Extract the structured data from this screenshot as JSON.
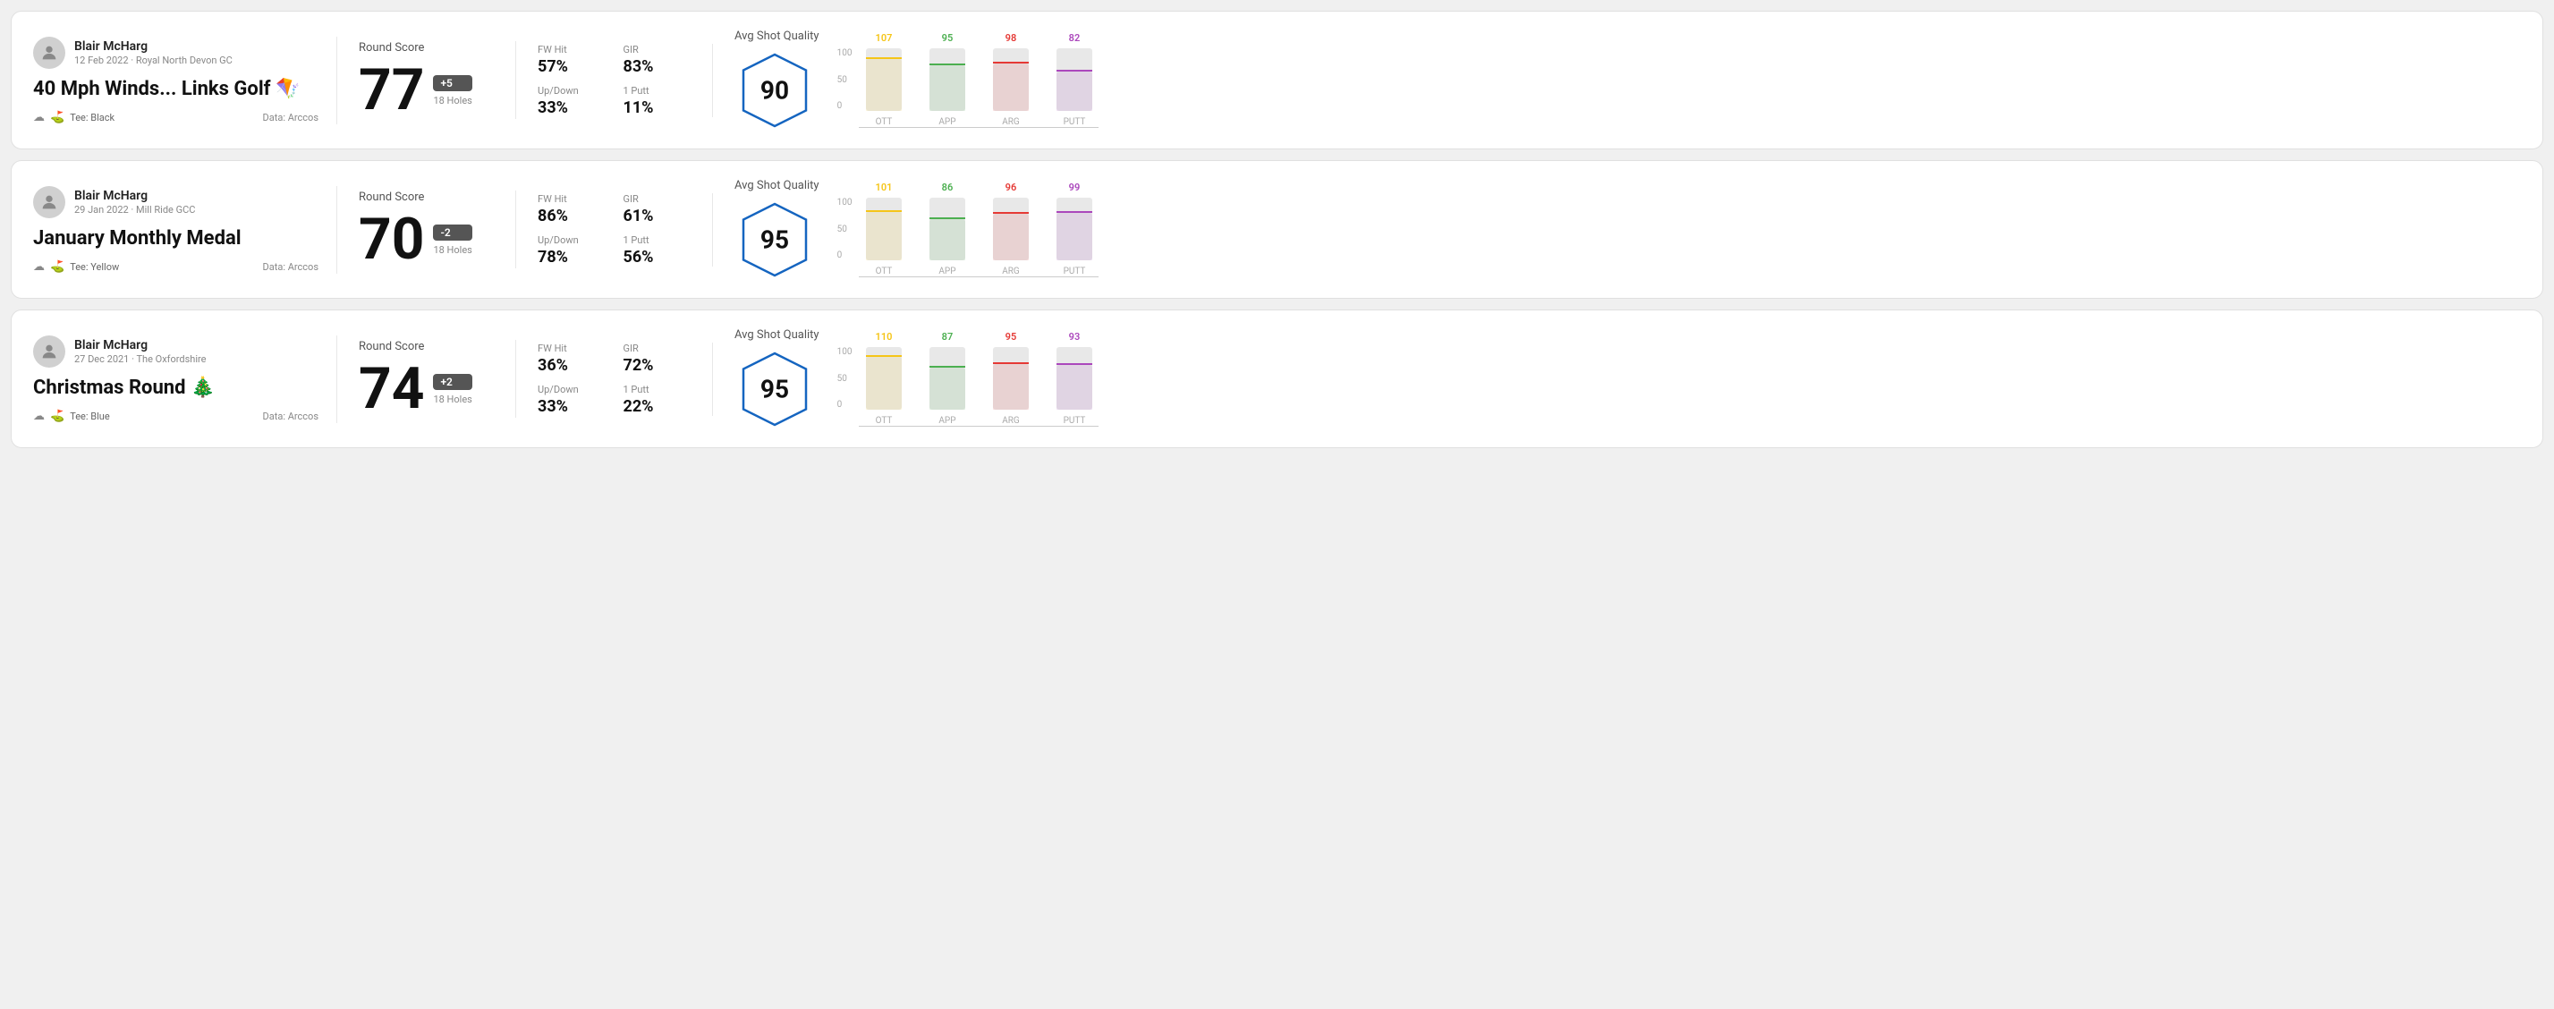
{
  "rounds": [
    {
      "id": "round-1",
      "user": {
        "name": "Blair McHarg",
        "date": "12 Feb 2022",
        "course": "Royal North Devon GC"
      },
      "title": "40 Mph Winds... Links Golf",
      "title_emoji": "🪁",
      "tee": "Black",
      "data_source": "Data: Arccos",
      "score": "77",
      "score_diff": "+5",
      "holes": "18 Holes",
      "fw_hit": "57%",
      "gir": "83%",
      "up_down": "33%",
      "one_putt": "11%",
      "avg_shot_quality": "90",
      "chart": {
        "bars": [
          {
            "cat": "OTT",
            "value": 107,
            "color": "#f5c518",
            "pct": 65
          },
          {
            "cat": "APP",
            "value": 95,
            "color": "#4caf50",
            "pct": 58
          },
          {
            "cat": "ARG",
            "value": 98,
            "color": "#e53935",
            "pct": 60
          },
          {
            "cat": "PUTT",
            "value": 82,
            "color": "#ab47bc",
            "pct": 50
          }
        ]
      }
    },
    {
      "id": "round-2",
      "user": {
        "name": "Blair McHarg",
        "date": "29 Jan 2022",
        "course": "Mill Ride GCC"
      },
      "title": "January Monthly Medal",
      "title_emoji": "",
      "tee": "Yellow",
      "data_source": "Data: Arccos",
      "score": "70",
      "score_diff": "-2",
      "holes": "18 Holes",
      "fw_hit": "86%",
      "gir": "61%",
      "up_down": "78%",
      "one_putt": "56%",
      "avg_shot_quality": "95",
      "chart": {
        "bars": [
          {
            "cat": "OTT",
            "value": 101,
            "color": "#f5c518",
            "pct": 62
          },
          {
            "cat": "APP",
            "value": 86,
            "color": "#4caf50",
            "pct": 53
          },
          {
            "cat": "ARG",
            "value": 96,
            "color": "#e53935",
            "pct": 59
          },
          {
            "cat": "PUTT",
            "value": 99,
            "color": "#ab47bc",
            "pct": 61
          }
        ]
      }
    },
    {
      "id": "round-3",
      "user": {
        "name": "Blair McHarg",
        "date": "27 Dec 2021",
        "course": "The Oxfordshire"
      },
      "title": "Christmas Round",
      "title_emoji": "🎄",
      "tee": "Blue",
      "data_source": "Data: Arccos",
      "score": "74",
      "score_diff": "+2",
      "holes": "18 Holes",
      "fw_hit": "36%",
      "gir": "72%",
      "up_down": "33%",
      "one_putt": "22%",
      "avg_shot_quality": "95",
      "chart": {
        "bars": [
          {
            "cat": "OTT",
            "value": 110,
            "color": "#f5c518",
            "pct": 67
          },
          {
            "cat": "APP",
            "value": 87,
            "color": "#4caf50",
            "pct": 53
          },
          {
            "cat": "ARG",
            "value": 95,
            "color": "#e53935",
            "pct": 58
          },
          {
            "cat": "PUTT",
            "value": 93,
            "color": "#ab47bc",
            "pct": 57
          }
        ]
      }
    }
  ],
  "labels": {
    "round_score": "Round Score",
    "fw_hit": "FW Hit",
    "gir": "GIR",
    "up_down": "Up/Down",
    "one_putt": "1 Putt",
    "avg_shot_quality": "Avg Shot Quality",
    "tee_prefix": "Tee:",
    "y_axis": [
      "100",
      "50",
      "0"
    ]
  }
}
